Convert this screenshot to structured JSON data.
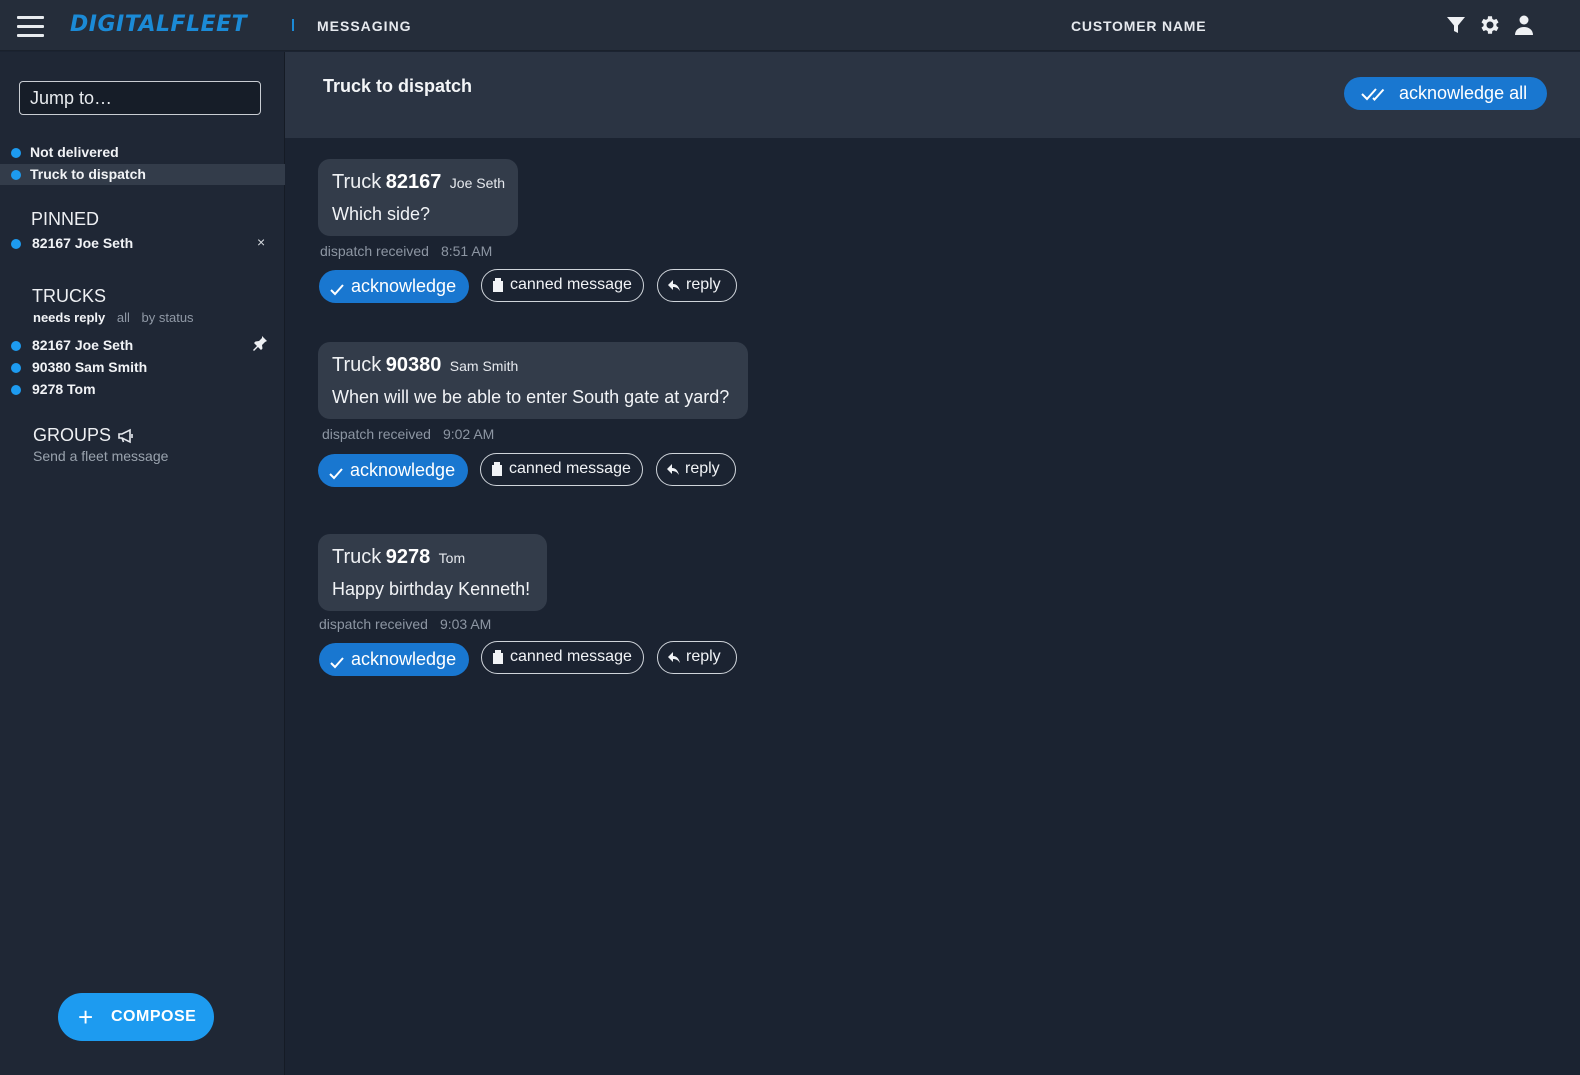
{
  "header": {
    "logo": "DIGITALFLEET",
    "app_name": "MESSAGING",
    "customer": "CUSTOMER NAME",
    "icons": [
      "menu-icon",
      "filter-icon",
      "gear-icon",
      "user-icon"
    ]
  },
  "sidebar": {
    "jump_placeholder": "Jump to…",
    "folders": [
      {
        "label": "Not delivered",
        "active": false
      },
      {
        "label": "Truck to dispatch",
        "active": true
      }
    ],
    "pinned": {
      "title": "PINNED",
      "items": [
        {
          "label": "82167 Joe Seth",
          "action": "×"
        }
      ]
    },
    "trucks": {
      "title": "TRUCKS",
      "filters": [
        "needs reply",
        "all",
        "by status"
      ],
      "items": [
        {
          "label": "82167 Joe Seth"
        },
        {
          "label": "90380 Sam Smith"
        },
        {
          "label": "9278 Tom"
        }
      ]
    },
    "groups": {
      "title": "GROUPS",
      "link": "Send a fleet message"
    },
    "compose_label": "COMPOSE"
  },
  "main": {
    "title": "Truck to dispatch",
    "ack_all_label": "acknowledge all",
    "accent_color": "#1977d0",
    "messages": [
      {
        "truck_word": "Truck",
        "number": "82167",
        "driver": "Joe Seth",
        "text": "Which side?",
        "status": "dispatch received",
        "time": "8:51 AM"
      },
      {
        "truck_word": "Truck",
        "number": "90380",
        "driver": "Sam Smith",
        "text": "When will we be able to enter South gate at yard?",
        "status": "dispatch received",
        "time": "9:02 AM"
      },
      {
        "truck_word": "Truck",
        "number": "9278",
        "driver": "Tom",
        "text": "Happy birthday Kenneth!",
        "status": "dispatch received",
        "time": "9:03 AM"
      }
    ],
    "actions": {
      "acknowledge": "acknowledge",
      "canned": "canned message",
      "reply": "reply"
    }
  }
}
